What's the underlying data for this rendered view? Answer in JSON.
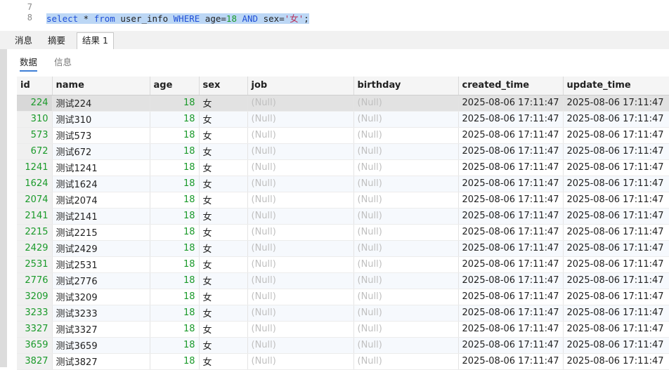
{
  "editor": {
    "lines": [
      {
        "no": "7"
      },
      {
        "no": "8"
      }
    ],
    "query": {
      "select": "select",
      "star": " * ",
      "from": "from",
      "table": " user_info ",
      "where": "WHERE",
      "cond1": " age=",
      "val1": "18",
      "and": " AND",
      "cond2": " sex=",
      "val2": "'女'",
      "end": ";"
    }
  },
  "tabs": [
    {
      "label": "消息"
    },
    {
      "label": "摘要"
    },
    {
      "label": "结果 1"
    }
  ],
  "subtabs": [
    {
      "label": "数据"
    },
    {
      "label": "信息"
    }
  ],
  "columns": [
    "id",
    "name",
    "age",
    "sex",
    "job",
    "birthday",
    "created_time",
    "update_time"
  ],
  "rows": [
    [
      "224",
      "测试224",
      "18",
      "女",
      "(Null)",
      "(Null)",
      "2025-08-06 17:11:47",
      "2025-08-06 17:11:47"
    ],
    [
      "310",
      "测试310",
      "18",
      "女",
      "(Null)",
      "(Null)",
      "2025-08-06 17:11:47",
      "2025-08-06 17:11:47"
    ],
    [
      "573",
      "测试573",
      "18",
      "女",
      "(Null)",
      "(Null)",
      "2025-08-06 17:11:47",
      "2025-08-06 17:11:47"
    ],
    [
      "672",
      "测试672",
      "18",
      "女",
      "(Null)",
      "(Null)",
      "2025-08-06 17:11:47",
      "2025-08-06 17:11:47"
    ],
    [
      "1241",
      "测试1241",
      "18",
      "女",
      "(Null)",
      "(Null)",
      "2025-08-06 17:11:47",
      "2025-08-06 17:11:47"
    ],
    [
      "1624",
      "测试1624",
      "18",
      "女",
      "(Null)",
      "(Null)",
      "2025-08-06 17:11:47",
      "2025-08-06 17:11:47"
    ],
    [
      "2074",
      "测试2074",
      "18",
      "女",
      "(Null)",
      "(Null)",
      "2025-08-06 17:11:47",
      "2025-08-06 17:11:47"
    ],
    [
      "2141",
      "测试2141",
      "18",
      "女",
      "(Null)",
      "(Null)",
      "2025-08-06 17:11:47",
      "2025-08-06 17:11:47"
    ],
    [
      "2215",
      "测试2215",
      "18",
      "女",
      "(Null)",
      "(Null)",
      "2025-08-06 17:11:47",
      "2025-08-06 17:11:47"
    ],
    [
      "2429",
      "测试2429",
      "18",
      "女",
      "(Null)",
      "(Null)",
      "2025-08-06 17:11:47",
      "2025-08-06 17:11:47"
    ],
    [
      "2531",
      "测试2531",
      "18",
      "女",
      "(Null)",
      "(Null)",
      "2025-08-06 17:11:47",
      "2025-08-06 17:11:47"
    ],
    [
      "2776",
      "测试2776",
      "18",
      "女",
      "(Null)",
      "(Null)",
      "2025-08-06 17:11:47",
      "2025-08-06 17:11:47"
    ],
    [
      "3209",
      "测试3209",
      "18",
      "女",
      "(Null)",
      "(Null)",
      "2025-08-06 17:11:47",
      "2025-08-06 17:11:47"
    ],
    [
      "3233",
      "测试3233",
      "18",
      "女",
      "(Null)",
      "(Null)",
      "2025-08-06 17:11:47",
      "2025-08-06 17:11:47"
    ],
    [
      "3327",
      "测试3327",
      "18",
      "女",
      "(Null)",
      "(Null)",
      "2025-08-06 17:11:47",
      "2025-08-06 17:11:47"
    ],
    [
      "3659",
      "测试3659",
      "18",
      "女",
      "(Null)",
      "(Null)",
      "2025-08-06 17:11:47",
      "2025-08-06 17:11:47"
    ],
    [
      "3827",
      "测试3827",
      "18",
      "女",
      "(Null)",
      "(Null)",
      "2025-08-06 17:11:47",
      "2025-08-06 17:11:47"
    ]
  ],
  "colors": {
    "keyword": "#1f4fd8",
    "number": "#1a9a2a",
    "string": "#b8325a",
    "selection": "#bcd7f5",
    "null_text": "#c0c0c0",
    "active_tab_underline": "#3f7fd6"
  }
}
